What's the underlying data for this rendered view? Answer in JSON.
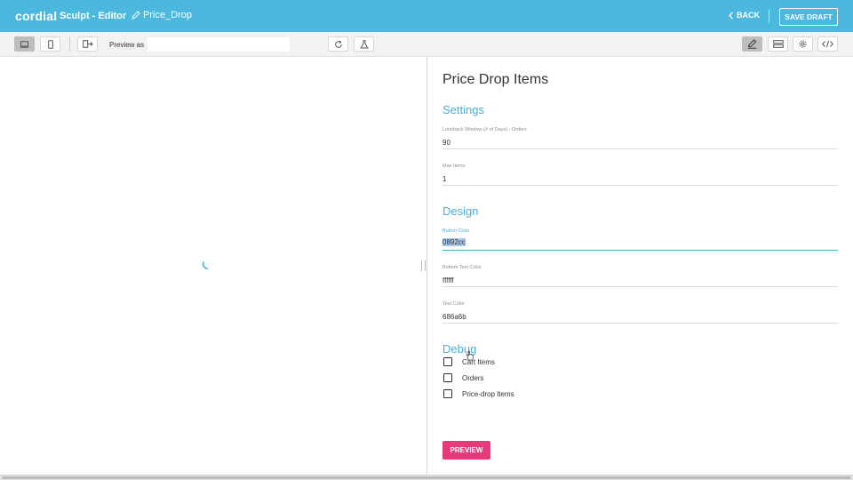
{
  "header": {
    "logo": "cordial",
    "app_title": "Sculpt - Editor",
    "doc_name": "Price_Drop",
    "back_label": "BACK",
    "save_label": "SAVE DRAFT"
  },
  "toolbar": {
    "preview_label": "Preview as",
    "preview_value": "",
    "icons": [
      "desktop-icon",
      "mobile-icon",
      "exit-icon",
      "refresh-icon",
      "flask-icon",
      "pencil-icon",
      "layout-icon",
      "gear-icon",
      "code-icon"
    ]
  },
  "panel": {
    "title": "Price Drop Items",
    "settings": {
      "heading": "Settings",
      "lookback_label": "Lookback Window (# of Days) - Orders",
      "lookback_value": "90",
      "max_items_label": "Max Items",
      "max_items_value": "1"
    },
    "design": {
      "heading": "Design",
      "button_color_label": "Button Color",
      "button_color_value": "0892cc",
      "button_text_color_label": "Bottom Text Color",
      "button_text_color_value": "ffffff",
      "text_color_label": "Text Color",
      "text_color_value": "686a6b"
    },
    "debug": {
      "heading": "Debug",
      "options": [
        "Cart Items",
        "Orders",
        "Price-drop Items"
      ]
    },
    "preview_button": "PREVIEW"
  },
  "colors": {
    "header_bg": "#4db8dd",
    "accent": "#4aaed8",
    "preview_button": "#e83a7a"
  }
}
